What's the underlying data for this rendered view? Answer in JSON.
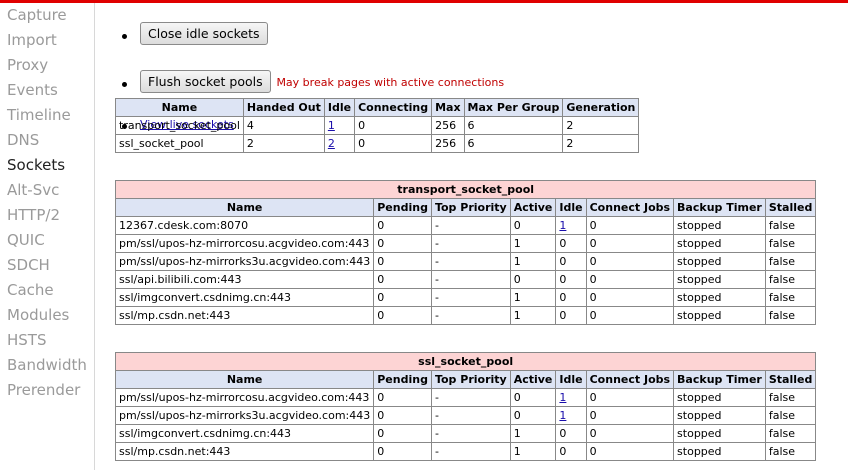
{
  "sidebar": {
    "items": [
      {
        "label": "Capture"
      },
      {
        "label": "Import"
      },
      {
        "label": "Proxy"
      },
      {
        "label": "Events"
      },
      {
        "label": "Timeline"
      },
      {
        "label": "DNS"
      },
      {
        "label": "Sockets",
        "active": true
      },
      {
        "label": "Alt-Svc"
      },
      {
        "label": "HTTP/2"
      },
      {
        "label": "QUIC"
      },
      {
        "label": "SDCH"
      },
      {
        "label": "Cache"
      },
      {
        "label": "Modules"
      },
      {
        "label": "HSTS"
      },
      {
        "label": "Bandwidth"
      },
      {
        "label": "Prerender"
      }
    ]
  },
  "actions": {
    "close_idle_label": "Close idle sockets",
    "flush_label": "Flush socket pools",
    "flush_warning": "May break pages with active connections",
    "view_live_label": "View live sockets"
  },
  "summary": {
    "headers": [
      "Name",
      "Handed Out",
      "Idle",
      "Connecting",
      "Max",
      "Max Per Group",
      "Generation"
    ],
    "rows": [
      [
        "transport_socket_pool",
        "4",
        "1",
        "0",
        "256",
        "6",
        "2"
      ],
      [
        "ssl_socket_pool",
        "2",
        "2",
        "0",
        "256",
        "6",
        "2"
      ]
    ]
  },
  "group_headers": [
    "Name",
    "Pending",
    "Top Priority",
    "Active",
    "Idle",
    "Connect Jobs",
    "Backup Timer",
    "Stalled"
  ],
  "transport_pool": {
    "caption": "transport_socket_pool",
    "rows": [
      [
        "12367.cdesk.com:8070",
        "0",
        "-",
        "0",
        "1",
        "0",
        "stopped",
        "false"
      ],
      [
        "pm/ssl/upos-hz-mirrorcosu.acgvideo.com:443",
        "0",
        "-",
        "1",
        "0",
        "0",
        "stopped",
        "false"
      ],
      [
        "pm/ssl/upos-hz-mirrorks3u.acgvideo.com:443",
        "0",
        "-",
        "1",
        "0",
        "0",
        "stopped",
        "false"
      ],
      [
        "ssl/api.bilibili.com:443",
        "0",
        "-",
        "0",
        "0",
        "0",
        "stopped",
        "false"
      ],
      [
        "ssl/imgconvert.csdnimg.cn:443",
        "0",
        "-",
        "1",
        "0",
        "0",
        "stopped",
        "false"
      ],
      [
        "ssl/mp.csdn.net:443",
        "0",
        "-",
        "1",
        "0",
        "0",
        "stopped",
        "false"
      ]
    ]
  },
  "ssl_pool": {
    "caption": "ssl_socket_pool",
    "rows": [
      [
        "pm/ssl/upos-hz-mirrorcosu.acgvideo.com:443",
        "0",
        "-",
        "0",
        "1",
        "0",
        "stopped",
        "false"
      ],
      [
        "pm/ssl/upos-hz-mirrorks3u.acgvideo.com:443",
        "0",
        "-",
        "0",
        "1",
        "0",
        "stopped",
        "false"
      ],
      [
        "ssl/imgconvert.csdnimg.cn:443",
        "0",
        "-",
        "1",
        "0",
        "0",
        "stopped",
        "false"
      ],
      [
        "ssl/mp.csdn.net:443",
        "0",
        "-",
        "1",
        "0",
        "0",
        "stopped",
        "false"
      ]
    ]
  },
  "colors": {
    "accent_bar": "#e00000",
    "header_bg": "#dde4f4",
    "caption_bg": "#fdd4d4",
    "warning": "#c00000",
    "link": "#1a0dab"
  }
}
